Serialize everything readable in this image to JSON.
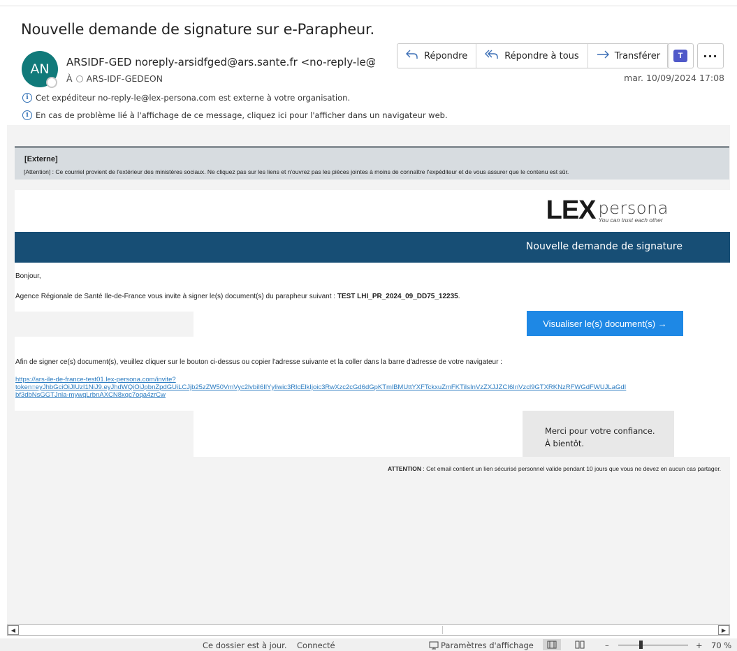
{
  "email": {
    "subject": "Nouvelle demande de signature sur e-Parapheur.",
    "avatar_initials": "AN",
    "sender": "ARSIDF-GED noreply-arsidfged@ars.sante.fr <no-reply-le@lex-persona.com>",
    "to_label": "À",
    "to_recipient": "ARS-IDF-GEDEON",
    "date": "mar. 10/09/2024 17:08",
    "info_external": "Cet expéditeur no-reply-le@lex-persona.com est externe à votre organisation.",
    "info_display": "En cas de problème lié à l'affichage de ce message, cliquez ici pour l'afficher dans un navigateur web."
  },
  "actions": {
    "reply": "Répondre",
    "reply_all": "Répondre à tous",
    "forward": "Transférer"
  },
  "body": {
    "external_title": "[Externe]",
    "external_text": "[Attention] : Ce courriel provient de l'extérieur des ministères sociaux. Ne cliquez pas sur les liens et n'ouvrez pas les pièces jointes à moins de connaître l'expéditeur et de vous assurer que le contenu est sûr.",
    "logo_lex": "LEX",
    "logo_persona": "persona",
    "logo_tagline": "You can trust each other",
    "banner": "Nouvelle demande de signature",
    "greeting": "Bonjour,",
    "invite_prefix": "Agence Régionale de Santé Ile-de-France vous invite à signer le(s) document(s) du parapheur suivant : ",
    "invite_doc": "TEST LHI_PR_2024_09_DD75_12235",
    "invite_suffix": ".",
    "cta": "Visualiser le(s) document(s) →",
    "afin": "Afin de signer ce(s) document(s), veuillez cliquer sur le bouton ci-dessus ou copier l'adresse suivante et la coller dans la barre d'adresse de votre navigateur :",
    "link_line1": "https://ars-ile-de-france-test01.lex-persona.com/invite?",
    "link_line2": "token=eyJhbGciOiJIUzI1NiJ9.eyJhdWQiOiJpbnZpdGUiLCJjb25zZW50VmVyc2lvbiI6IlYyliwic3RlcElkIjoic3RwXzc2cGd6dGpKTmlBMUttYXFTckxuZmFKTiIsInVzZXJJZCI6InVzcl9GTXRKNzRFWGdFWUJLaGdI",
    "link_line3": "bf3dbNsGGTJnla-mywqLrbnAXCN8xqc7oqa4zrCw",
    "merci_line1": "Merci pour votre confiance.",
    "merci_line2": "À bientôt.",
    "attention_label": "ATTENTION",
    "attention_text": " : Cet email contient un lien sécurisé personnel valide pendant 10 jours que vous ne devez en aucun cas partager."
  },
  "status": {
    "folder_status": "Ce dossier est à jour.",
    "connection": "Connecté",
    "display_settings": "Paramètres d'affichage",
    "zoom_minus": "–",
    "zoom_plus": "+",
    "zoom_level": "70 %"
  }
}
